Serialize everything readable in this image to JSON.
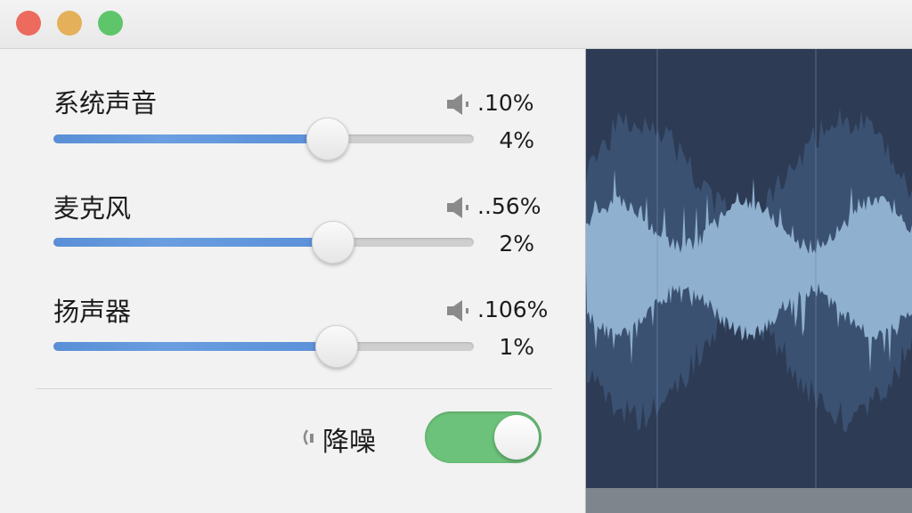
{
  "window": {
    "close_icon": "close-button",
    "minimize_icon": "minimize-button",
    "maximize_icon": "maximize-button"
  },
  "audio": {
    "rows": [
      {
        "label": "系统声音",
        "value_top": ".10%",
        "percent": "4%",
        "level": 0.65
      },
      {
        "label": "麦克风",
        "value_top": "..56%",
        "percent": "2%",
        "level": 0.66
      },
      {
        "label": "扬声器",
        "value_top": ".106%",
        "percent": "1%",
        "level": 0.67
      }
    ],
    "noise_reduction": {
      "label": "降噪",
      "enabled": true
    }
  },
  "colors": {
    "slider_fill": "#5a8ed6",
    "toggle_on": "#6cc27a",
    "waveform_bg": "#2e3c55",
    "waveform_light": "#8fb0cf"
  },
  "icons": {
    "speaker": "speaker-icon",
    "noise": "noise-reduction-icon"
  }
}
